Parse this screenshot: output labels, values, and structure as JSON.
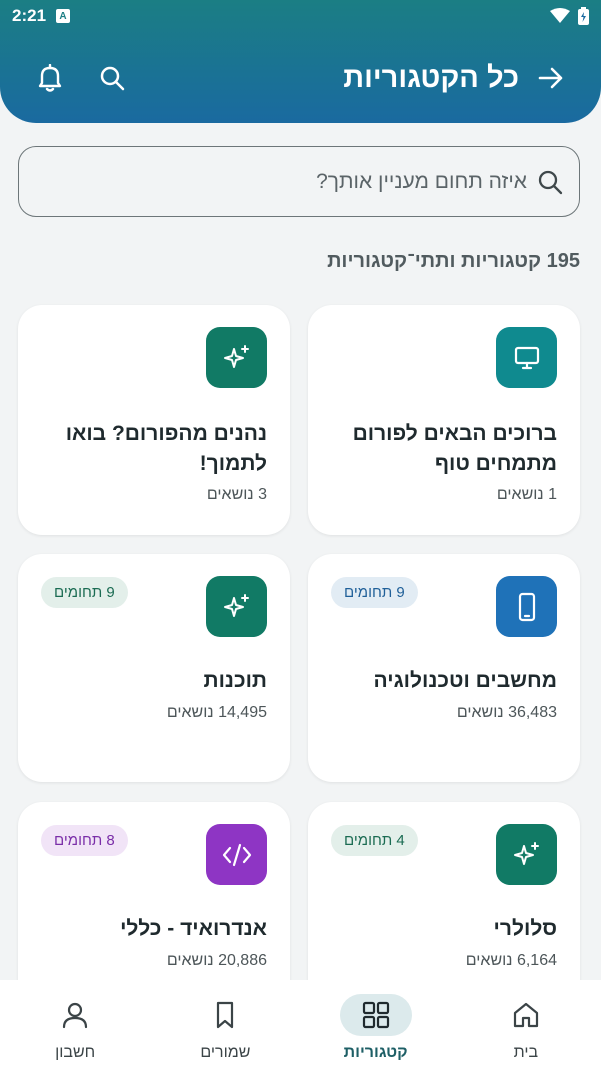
{
  "status_bar": {
    "time": "2:21",
    "badge_letter": "A"
  },
  "header": {
    "title": "כל הקטגוריות"
  },
  "search": {
    "placeholder": "איזה תחום מעניין אותך?"
  },
  "summary": {
    "count_text": "195 קטגוריות ותתי־קטגוריות"
  },
  "cards": [
    {
      "title": "ברוכים הבאים לפורום מתמחים טוף",
      "meta": "1 נושאים",
      "badge": "",
      "icon": "monitor-icon",
      "icon_bg": "#0f8a8f"
    },
    {
      "title": "נהנים מהפורום? בואו לתמוך!",
      "meta": "3 נושאים",
      "badge": "",
      "icon": "sparkle-icon",
      "icon_bg": "#117a65"
    },
    {
      "title": "מחשבים וטכנולוגיה",
      "meta": "36,483 נושאים",
      "badge": "9 תחומים",
      "icon": "smartphone-icon",
      "icon_bg": "#1f72b8",
      "badge_bg": "#e2ecf4",
      "badge_color": "#1f5f98"
    },
    {
      "title": "תוכנות",
      "meta": "14,495 נושאים",
      "badge": "9 תחומים",
      "icon": "sparkle-icon",
      "icon_bg": "#117a65",
      "badge_bg": "#e3efea",
      "badge_color": "#1a6b52"
    },
    {
      "title": "סלולרי",
      "meta": "6,164 נושאים",
      "badge": "4 תחומים",
      "icon": "sparkle-icon",
      "icon_bg": "#117a65",
      "badge_bg": "#e3efea",
      "badge_color": "#1a6b52"
    },
    {
      "title": "אנדרואיד - כללי",
      "meta": "20,886 נושאים",
      "badge": "8 תחומים",
      "icon": "code-icon",
      "icon_bg": "#8e35c4",
      "badge_bg": "#f1e4f7",
      "badge_color": "#7a2ea8"
    }
  ],
  "bottom_nav": [
    {
      "label": "בית",
      "icon": "home-icon",
      "active": false
    },
    {
      "label": "קטגוריות",
      "icon": "grid-icon",
      "active": true
    },
    {
      "label": "שמורים",
      "icon": "bookmark-icon",
      "active": false
    },
    {
      "label": "חשבון",
      "icon": "person-icon",
      "active": false
    }
  ],
  "colors": {
    "header_top": "#1b7e84",
    "header_bottom": "#1a6aa0",
    "background": "#f2f4f5",
    "accent": "#1e5f66"
  }
}
